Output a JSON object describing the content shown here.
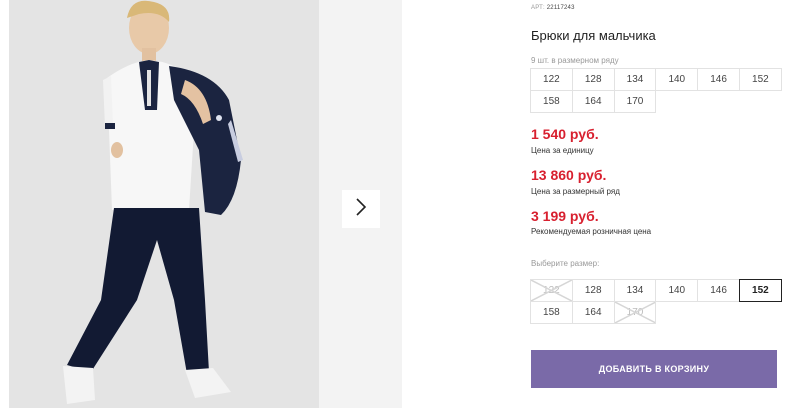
{
  "product": {
    "article_label": "АРТ:",
    "article_number": "22117243",
    "title": "Брюки для мальчика"
  },
  "gallery": {
    "next_icon": "chevron-right-icon"
  },
  "range": {
    "label": "9 шт. в размерном ряду",
    "sizes": [
      "122",
      "128",
      "134",
      "140",
      "146",
      "152",
      "158",
      "164",
      "170"
    ]
  },
  "prices": {
    "unit_price": "1 540 руб.",
    "unit_note": "Цена за единицу",
    "range_price": "13 860 руб.",
    "range_note": "Цена за размерный ряд",
    "retail_price": "3 199 руб.",
    "retail_note": "Рекомендуемая розничная цена"
  },
  "size_picker": {
    "label": "Выберите размер:",
    "sizes": [
      {
        "label": "122",
        "available": false,
        "selected": false
      },
      {
        "label": "128",
        "available": true,
        "selected": false
      },
      {
        "label": "134",
        "available": true,
        "selected": false
      },
      {
        "label": "140",
        "available": true,
        "selected": false
      },
      {
        "label": "146",
        "available": true,
        "selected": false
      },
      {
        "label": "152",
        "available": true,
        "selected": true
      },
      {
        "label": "158",
        "available": true,
        "selected": false
      },
      {
        "label": "164",
        "available": true,
        "selected": false
      },
      {
        "label": "170",
        "available": false,
        "selected": false
      }
    ]
  },
  "cart": {
    "button_label": "ДОБАВИТЬ В КОРЗИНУ"
  },
  "colors": {
    "price": "#d8202f",
    "button": "#7a6aa8",
    "navy": "#1b2440"
  }
}
